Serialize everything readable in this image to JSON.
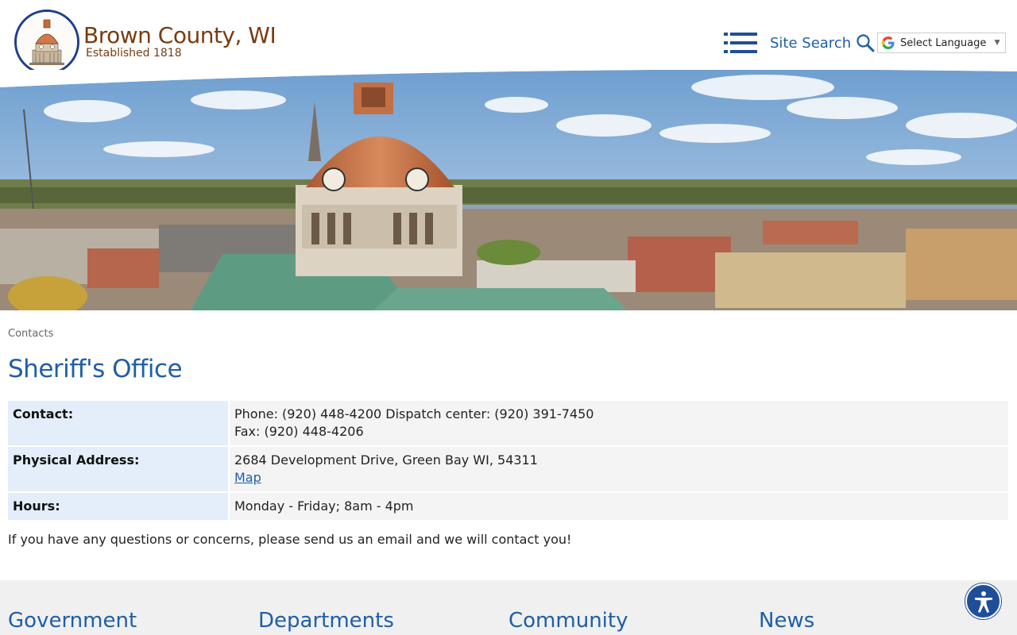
{
  "header": {
    "site_name": "Brown County, WI",
    "tagline": "Established 1818",
    "search_label": "Site Search",
    "language_label": "Select Language"
  },
  "breadcrumb": "Contacts",
  "page_title": "Sheriff's Office",
  "contact_rows": [
    {
      "label": "Contact:",
      "lines": [
        "Phone: (920) 448-4200 Dispatch center: (920) 391-7450",
        "Fax: (920) 448-4206"
      ]
    },
    {
      "label": "Physical Address:",
      "lines": [
        "2684 Development Drive, Green Bay WI, 54311"
      ],
      "link": "Map"
    },
    {
      "label": "Hours:",
      "lines": [
        "Monday - Friday; 8am - 4pm"
      ]
    }
  ],
  "note": "If you have any questions or concerns, please send us an email and we will contact you!",
  "footer": {
    "columns": [
      "Government",
      "Departments",
      "Community",
      "News"
    ]
  },
  "icons": {
    "menu": "hamburger-list-icon",
    "search": "magnifier-icon",
    "language": "google-g-icon",
    "accessibility": "accessibility-person-icon"
  },
  "colors": {
    "brand_blue": "#1f5ea8",
    "brand_brown": "#7a3b10",
    "label_bg": "#e3eefa",
    "value_bg": "#f4f4f4",
    "footer_bg": "#f0f0f0"
  }
}
